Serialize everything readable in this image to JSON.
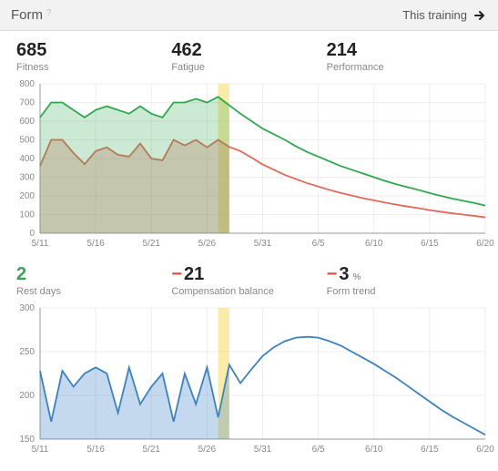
{
  "header": {
    "title": "Form",
    "help": "?",
    "right_label": "This training"
  },
  "metrics_top": [
    {
      "value": "685",
      "label": "Fitness",
      "sign": ""
    },
    {
      "value": "462",
      "label": "Fatigue",
      "sign": ""
    },
    {
      "value": "214",
      "label": "Performance",
      "sign": ""
    }
  ],
  "metrics_bottom": [
    {
      "value": "2",
      "label": "Rest days",
      "sign": "pos",
      "suffix": ""
    },
    {
      "value": "21",
      "label": "Compensation balance",
      "sign": "neg",
      "prefix": "−",
      "suffix": ""
    },
    {
      "value": "3",
      "label": "Form trend",
      "sign": "neg",
      "prefix": "−",
      "suffix": "%"
    }
  ],
  "chart_data": [
    {
      "type": "line",
      "title": "",
      "xlabel": "",
      "ylabel": "",
      "ylim": [
        0,
        800
      ],
      "x_ticks": [
        "5/11",
        "5/16",
        "5/21",
        "5/26",
        "5/31",
        "6/5",
        "6/10",
        "6/15",
        "6/20"
      ],
      "y_ticks": [
        0,
        100,
        200,
        300,
        400,
        500,
        600,
        700,
        800
      ],
      "highlight_band": {
        "from": "5/27",
        "to": "5/28",
        "color": "#f7e06a"
      },
      "x": [
        "5/11",
        "5/12",
        "5/13",
        "5/14",
        "5/15",
        "5/16",
        "5/17",
        "5/18",
        "5/19",
        "5/20",
        "5/21",
        "5/22",
        "5/23",
        "5/24",
        "5/25",
        "5/26",
        "5/27",
        "5/28",
        "5/29",
        "5/30",
        "5/31",
        "6/1",
        "6/2",
        "6/3",
        "6/4",
        "6/5",
        "6/6",
        "6/7",
        "6/8",
        "6/9",
        "6/10",
        "6/11",
        "6/12",
        "6/13",
        "6/14",
        "6/15",
        "6/16",
        "6/17",
        "6/18",
        "6/19",
        "6/20"
      ],
      "series": [
        {
          "name": "Fitness",
          "color": "#2fa84f",
          "fill": "rgba(47,168,79,0.25)",
          "fill_until_index": 17,
          "values": [
            620,
            700,
            700,
            660,
            620,
            660,
            680,
            660,
            640,
            680,
            640,
            620,
            700,
            700,
            720,
            700,
            730,
            685,
            640,
            600,
            560,
            530,
            500,
            465,
            435,
            410,
            385,
            360,
            340,
            320,
            300,
            280,
            262,
            247,
            232,
            215,
            200,
            186,
            174,
            162,
            148
          ]
        },
        {
          "name": "Fatigue",
          "color": "#e06a5a",
          "fill": "rgba(224,106,90,0.30)",
          "fill_until_index": 17,
          "values": [
            360,
            500,
            500,
            430,
            370,
            440,
            460,
            420,
            410,
            480,
            400,
            390,
            500,
            470,
            500,
            460,
            500,
            462,
            440,
            405,
            368,
            340,
            312,
            290,
            268,
            250,
            232,
            216,
            202,
            188,
            176,
            164,
            153,
            143,
            134,
            124,
            115,
            107,
            100,
            93,
            85
          ]
        }
      ]
    },
    {
      "type": "line",
      "title": "",
      "xlabel": "",
      "ylabel": "",
      "ylim": [
        150,
        300
      ],
      "x_ticks": [
        "5/11",
        "5/16",
        "5/21",
        "5/26",
        "5/31",
        "6/5",
        "6/10",
        "6/15",
        "6/20"
      ],
      "y_ticks": [
        150,
        200,
        250,
        300
      ],
      "highlight_band": {
        "from": "5/27",
        "to": "5/28",
        "color": "#f7e06a"
      },
      "x": [
        "5/11",
        "5/12",
        "5/13",
        "5/14",
        "5/15",
        "5/16",
        "5/17",
        "5/18",
        "5/19",
        "5/20",
        "5/21",
        "5/22",
        "5/23",
        "5/24",
        "5/25",
        "5/26",
        "5/27",
        "5/28",
        "5/29",
        "5/30",
        "5/31",
        "6/1",
        "6/2",
        "6/3",
        "6/4",
        "6/5",
        "6/6",
        "6/7",
        "6/8",
        "6/9",
        "6/10",
        "6/11",
        "6/12",
        "6/13",
        "6/14",
        "6/15",
        "6/16",
        "6/17",
        "6/18",
        "6/19",
        "6/20"
      ],
      "series": [
        {
          "name": "Performance",
          "color": "#3b82c4",
          "fill": "rgba(59,130,196,0.30)",
          "fill_until_index": 17,
          "values": [
            228,
            170,
            228,
            210,
            225,
            232,
            225,
            180,
            232,
            190,
            210,
            225,
            170,
            225,
            190,
            232,
            175,
            235,
            214,
            230,
            245,
            255,
            262,
            266,
            267,
            266,
            262,
            257,
            250,
            243,
            236,
            228,
            220,
            211,
            202,
            193,
            184,
            176,
            169,
            162,
            155
          ]
        }
      ]
    }
  ]
}
